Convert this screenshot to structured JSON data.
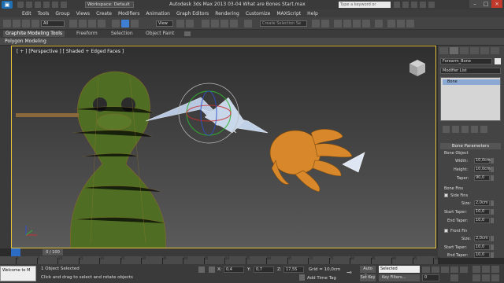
{
  "app": {
    "workspace": "Workspace: Default",
    "title": "Autodesk 3ds Max 2013    03-04 What are Bones Start.max",
    "search_placeholder": "Type a keyword or phrase"
  },
  "menu": [
    "Edit",
    "Tools",
    "Group",
    "Views",
    "Create",
    "Modifiers",
    "Animation",
    "Graph Editors",
    "Rendering",
    "Customize",
    "MAXScript",
    "Help"
  ],
  "toolbar": {
    "selection_filter": "All",
    "reference_coord": "View",
    "named_selection_placeholder": "Create Selection Se"
  },
  "ribbon": {
    "tabs": [
      "Graphite Modeling Tools",
      "Freeform",
      "Selection",
      "Object Paint"
    ],
    "active_tab": "Graphite Modeling Tools",
    "sub_label": "Polygon Modeling"
  },
  "viewport": {
    "label": "[ + ] [Perspective ] [ Shaded + Edged Faces ]"
  },
  "command_panel": {
    "object_name": "Forearm_Bone",
    "object_color": "#e8e8e8",
    "modifier_list": "Modifier List",
    "stack_item": "Bone",
    "rollout_title": "Bone Parameters",
    "group_bone_object": "Bone Object",
    "width_label": "Width:",
    "width_value": "10,0cm",
    "height_label": "Height:",
    "height_value": "10,0cm",
    "taper_label": "Taper:",
    "taper_value": "90,0",
    "group_bone_fins": "Bone Fins",
    "side_fins": "Side Fins",
    "size_label": "Size:",
    "side_size": "2,0cm",
    "start_taper_label": "Start Taper:",
    "side_start_taper": "10,0",
    "end_taper_label": "End Taper:",
    "side_end_taper": "10,0",
    "front_fin": "Front Fin",
    "front_size": "2,0cm",
    "front_start_taper": "10,0",
    "front_end_taper": "10,0"
  },
  "timeline": {
    "frame_display": "0 / 100",
    "ticks": [
      "0",
      "5",
      "10",
      "15",
      "20",
      "25",
      "30",
      "35",
      "40",
      "45",
      "50",
      "55",
      "60",
      "65",
      "70",
      "75",
      "80",
      "85",
      "90",
      "95",
      "100"
    ]
  },
  "status": {
    "maxscript_text": "Welcome to M",
    "selection_info": "1 Object Selected",
    "prompt": "Click and drag to select and rotate objects",
    "x_label": "X:",
    "x_value": "0,4",
    "y_label": "Y:",
    "y_value": "0,7",
    "z_label": "Z:",
    "z_value": "17,55",
    "grid": "Grid = 10,0cm",
    "add_time_tag": "Add Time Tag",
    "auto_key": "Auto Key",
    "set_key": "Set Key",
    "selected_dropdown": "Selected",
    "key_filters": "Key Filters...",
    "current_time": "0"
  },
  "colors": {
    "accent_blue": "#3f7fd6",
    "viewport_border": "#e8c23a",
    "character_green": "#5a7a2a",
    "hand_orange": "#d8882a"
  }
}
